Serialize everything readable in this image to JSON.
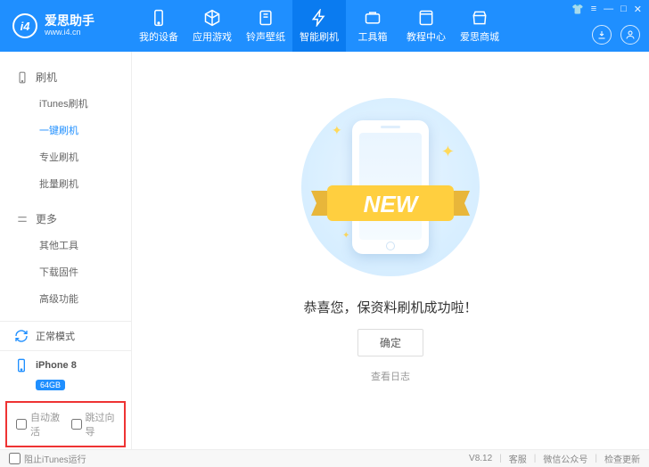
{
  "brand": {
    "name": "爱思助手",
    "url": "www.i4.cn",
    "logo_text": "i4"
  },
  "header_tabs": [
    {
      "label": "我的设备",
      "icon": "phone"
    },
    {
      "label": "应用游戏",
      "icon": "app"
    },
    {
      "label": "铃声壁纸",
      "icon": "note"
    },
    {
      "label": "智能刷机",
      "icon": "flash",
      "active": true
    },
    {
      "label": "工具箱",
      "icon": "tool"
    },
    {
      "label": "教程中心",
      "icon": "book"
    },
    {
      "label": "爱思商城",
      "icon": "store"
    }
  ],
  "sidebar": {
    "sections": [
      {
        "title": "刷机",
        "items": [
          "iTunes刷机",
          "一键刷机",
          "专业刷机",
          "批量刷机"
        ],
        "active_index": 1
      },
      {
        "title": "更多",
        "items": [
          "其他工具",
          "下载固件",
          "高级功能"
        ],
        "active_index": -1
      }
    ],
    "mode": "正常模式",
    "device": {
      "name": "iPhone 8",
      "storage": "64GB"
    },
    "options": {
      "auto_activate": "自动激活",
      "skip_guide": "跳过向导"
    }
  },
  "main": {
    "ribbon_text": "NEW",
    "message": "恭喜您，保资料刷机成功啦！",
    "ok": "确定",
    "log": "查看日志"
  },
  "footer": {
    "block_itunes": "阻止iTunes运行",
    "version": "V8.12",
    "links": [
      "客服",
      "微信公众号",
      "检查更新"
    ]
  }
}
